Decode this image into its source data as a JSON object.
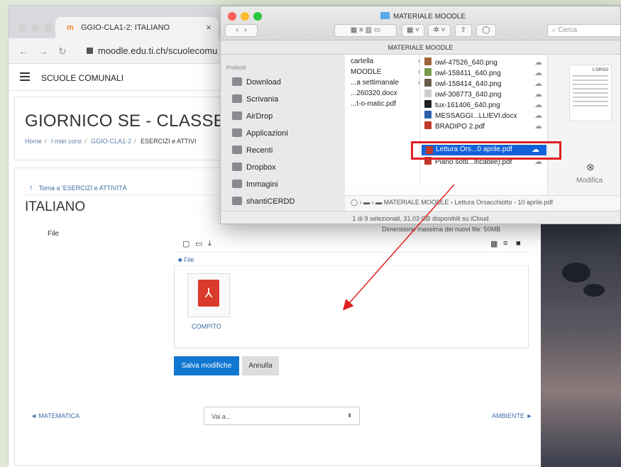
{
  "browser": {
    "tab_title": "GGIO-CLA1-2: ITALIANO",
    "tab_favicon": "m",
    "tab_close": "×",
    "url": "moodle.edu.ti.ch/scuolecomu"
  },
  "moodle": {
    "site_name": "SCUOLE COMUNALI",
    "course_title": "GIORNICO SE - CLASSE",
    "breadcrumb": [
      "Home",
      "I miei corsi",
      "GGIO-CLA1-2",
      "ESERCIZI e ATTIVI"
    ],
    "back_link": "Torna a 'ESERCIZI e ATTIVITÀ",
    "page_title": "ITALIANO",
    "file_label": "File",
    "fm_path": "File",
    "file_name": "COMPITO",
    "save_label": "Salva modifiche",
    "cancel_label": "Annulla",
    "prev_link": "◄ MATEMATICA",
    "jump_placeholder": "Vai a...",
    "next_link": "AMBIENTE ►",
    "max_size": "Dimensione massima dei nuovi file: 50MB"
  },
  "finder": {
    "window_title": "MATERIALE MOODLE",
    "path_title": "MATERIALE MOODLE",
    "search_placeholder": "Cerca",
    "sidebar_header": "Preferiti",
    "sidebar_items": [
      "Download",
      "Scrivania",
      "AirDrop",
      "Applicazioni",
      "Recenti",
      "Dropbox",
      "Immagini",
      "shantiCERDD"
    ],
    "column1": [
      "cartella",
      "MOODLE",
      "...a settimanale",
      "...260320.docx",
      "...t-o-matic.pdf"
    ],
    "column2": [
      "owl-47526_640.png",
      "owl-158411_640.png",
      "owl-158414_640.png",
      "owl-308773_640.png",
      "tux-161406_640.png",
      "MESSAGGI...LLIEVI.docx",
      "BRADIPO 2.pdf",
      "Lettura Ors...0 aprile.pdf",
      "Piano sotti...ificabile).pdf"
    ],
    "selected_file": "Lettura Ors...0 aprile.pdf",
    "preview_title": "L'ORSO",
    "preview_action": "Modifica",
    "pathbar": "MATERIALE MOODLE › Lettura Orsacchiotto - 10 aprile.pdf",
    "status": "1 di 9 selezionati, 31,03 GB disponibili su iCloud"
  },
  "colors": {
    "moodle_blue": "#1177d1",
    "link_blue": "#3d6da5",
    "selection_blue": "#1162d8",
    "annotation_red": "#e02020"
  }
}
